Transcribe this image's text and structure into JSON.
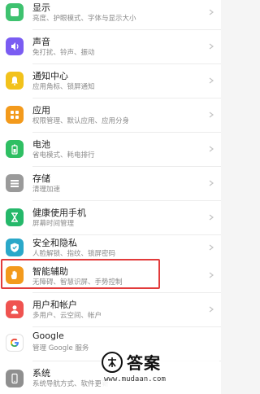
{
  "settings_list": [
    {
      "title": "显示",
      "subtitle": "亮度、护眼模式、字体与显示大小",
      "icon": "display-icon",
      "color": "#3ec26f"
    },
    {
      "title": "声音",
      "subtitle": "免打扰、铃声、振动",
      "icon": "sound-icon",
      "color": "#7a5cf2"
    },
    {
      "title": "通知中心",
      "subtitle": "应用角标、锁屏通知",
      "icon": "notification-bell-icon",
      "color": "#f2c21b"
    },
    {
      "title": "应用",
      "subtitle": "权限管理、默认应用、应用分身",
      "icon": "apps-grid-icon",
      "color": "#f39a1c"
    },
    {
      "title": "电池",
      "subtitle": "省电模式、耗电排行",
      "icon": "battery-icon",
      "color": "#2fbf63"
    },
    {
      "title": "存储",
      "subtitle": "清理加速",
      "icon": "storage-icon",
      "color": "#9a9a9a"
    },
    {
      "title": "健康使用手机",
      "subtitle": "屏幕时间管理",
      "icon": "hourglass-icon",
      "color": "#25b86a"
    },
    {
      "title": "安全和隐私",
      "subtitle": "人脸解锁、指纹、锁屏密码",
      "icon": "shield-icon",
      "color": "#2aa8c9"
    },
    {
      "title": "智能辅助",
      "subtitle": "无障碍、智慧识屏、手势控制",
      "icon": "hand-icon",
      "color": "#f39a1c"
    },
    {
      "title": "用户和帐户",
      "subtitle": "多用户、云空间、帐户",
      "icon": "user-icon",
      "color": "#ef5350"
    },
    {
      "title": "Google",
      "subtitle": "管理 Google 服务",
      "icon": "google-icon",
      "color": "#ffffff"
    },
    {
      "title": "系统",
      "subtitle": "系统导航方式、软件更新",
      "icon": "phone-system-icon",
      "color": "#8f8f8f"
    }
  ],
  "watermark": {
    "name": "答案",
    "url": "www.mudaan.com"
  }
}
